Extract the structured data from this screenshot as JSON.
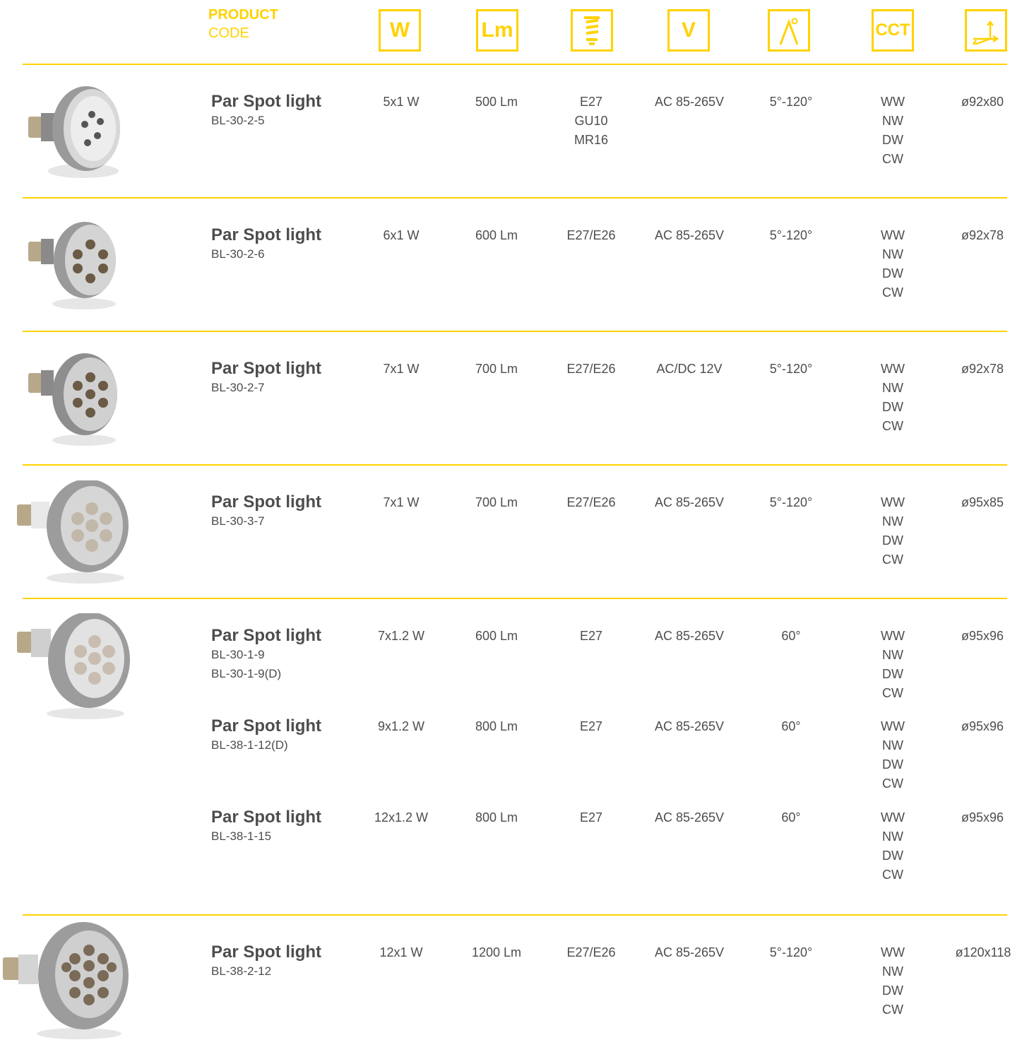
{
  "header": {
    "product": "PRODUCT",
    "code": "CODE",
    "icons": [
      {
        "name": "watt-icon",
        "text": "W"
      },
      {
        "name": "lumen-icon",
        "text": "Lm"
      },
      {
        "name": "socket-icon",
        "text": ""
      },
      {
        "name": "voltage-icon",
        "text": "V"
      },
      {
        "name": "beam-angle-icon",
        "text": ""
      },
      {
        "name": "cct-icon",
        "text": "CCT"
      },
      {
        "name": "dimensions-icon",
        "text": ""
      }
    ],
    "accent_color": "#ffd200"
  },
  "products": [
    {
      "title": "Par Spot light",
      "codes": [
        "BL-30-2-5"
      ],
      "watt": "5x1 W",
      "lumen": "500 Lm",
      "socket": [
        "E27",
        "GU10",
        "MR16"
      ],
      "voltage": "AC 85-265V",
      "angle": "5°-120°",
      "cct": [
        "WW",
        "NW",
        "DW",
        "CW"
      ],
      "size": "ø92x80"
    },
    {
      "title": "Par Spot light",
      "codes": [
        "BL-30-2-6"
      ],
      "watt": "6x1 W",
      "lumen": "600 Lm",
      "socket": [
        "E27/E26"
      ],
      "voltage": "AC 85-265V",
      "angle": "5°-120°",
      "cct": [
        "WW",
        "NW",
        "DW",
        "CW"
      ],
      "size": "ø92x78"
    },
    {
      "title": "Par Spot light",
      "codes": [
        "BL-30-2-7"
      ],
      "watt": "7x1 W",
      "lumen": "700 Lm",
      "socket": [
        "E27/E26"
      ],
      "voltage": "AC/DC 12V",
      "angle": "5°-120°",
      "cct": [
        "WW",
        "NW",
        "DW",
        "CW"
      ],
      "size": "ø92x78"
    },
    {
      "title": "Par Spot light",
      "codes": [
        "BL-30-3-7"
      ],
      "watt": "7x1 W",
      "lumen": "700 Lm",
      "socket": [
        "E27/E26"
      ],
      "voltage": "AC 85-265V",
      "angle": "5°-120°",
      "cct": [
        "WW",
        "NW",
        "DW",
        "CW"
      ],
      "size": "ø95x85"
    },
    {
      "title": "Par Spot light",
      "codes": [
        "BL-30-1-9",
        "BL-30-1-9(D)"
      ],
      "watt": "7x1.2 W",
      "lumen": "600 Lm",
      "socket": [
        "E27"
      ],
      "voltage": "AC 85-265V",
      "angle": "60°",
      "cct": [
        "WW",
        "NW",
        "DW",
        "CW"
      ],
      "size": "ø95x96"
    },
    {
      "title": "Par Spot light",
      "codes": [
        "BL-38-1-12(D)"
      ],
      "watt": "9x1.2 W",
      "lumen": "800 Lm",
      "socket": [
        "E27"
      ],
      "voltage": "AC 85-265V",
      "angle": "60°",
      "cct": [
        "WW",
        "NW",
        "DW",
        "CW"
      ],
      "size": "ø95x96"
    },
    {
      "title": "Par Spot light",
      "codes": [
        "BL-38-1-15"
      ],
      "watt": "12x1.2 W",
      "lumen": "800 Lm",
      "socket": [
        "E27"
      ],
      "voltage": "AC 85-265V",
      "angle": "60°",
      "cct": [
        "WW",
        "NW",
        "DW",
        "CW"
      ],
      "size": "ø95x96"
    },
    {
      "title": "Par Spot light",
      "codes": [
        "BL-38-2-12"
      ],
      "watt": "12x1 W",
      "lumen": "1200 Lm",
      "socket": [
        "E27/E26"
      ],
      "voltage": "AC 85-265V",
      "angle": "5°-120°",
      "cct": [
        "WW",
        "NW",
        "DW",
        "CW"
      ],
      "size": "ø120x118"
    }
  ]
}
